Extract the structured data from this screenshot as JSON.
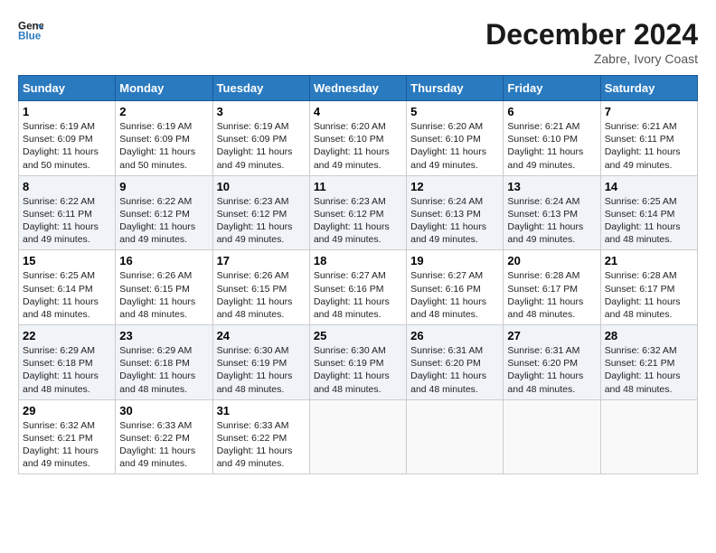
{
  "header": {
    "logo_line1": "General",
    "logo_line2": "Blue",
    "month": "December 2024",
    "location": "Zabre, Ivory Coast"
  },
  "days_of_week": [
    "Sunday",
    "Monday",
    "Tuesday",
    "Wednesday",
    "Thursday",
    "Friday",
    "Saturday"
  ],
  "weeks": [
    [
      {
        "day": "1",
        "sunrise": "6:19 AM",
        "sunset": "6:09 PM",
        "daylight": "11 hours and 50 minutes."
      },
      {
        "day": "2",
        "sunrise": "6:19 AM",
        "sunset": "6:09 PM",
        "daylight": "11 hours and 50 minutes."
      },
      {
        "day": "3",
        "sunrise": "6:19 AM",
        "sunset": "6:09 PM",
        "daylight": "11 hours and 49 minutes."
      },
      {
        "day": "4",
        "sunrise": "6:20 AM",
        "sunset": "6:10 PM",
        "daylight": "11 hours and 49 minutes."
      },
      {
        "day": "5",
        "sunrise": "6:20 AM",
        "sunset": "6:10 PM",
        "daylight": "11 hours and 49 minutes."
      },
      {
        "day": "6",
        "sunrise": "6:21 AM",
        "sunset": "6:10 PM",
        "daylight": "11 hours and 49 minutes."
      },
      {
        "day": "7",
        "sunrise": "6:21 AM",
        "sunset": "6:11 PM",
        "daylight": "11 hours and 49 minutes."
      }
    ],
    [
      {
        "day": "8",
        "sunrise": "6:22 AM",
        "sunset": "6:11 PM",
        "daylight": "11 hours and 49 minutes."
      },
      {
        "day": "9",
        "sunrise": "6:22 AM",
        "sunset": "6:12 PM",
        "daylight": "11 hours and 49 minutes."
      },
      {
        "day": "10",
        "sunrise": "6:23 AM",
        "sunset": "6:12 PM",
        "daylight": "11 hours and 49 minutes."
      },
      {
        "day": "11",
        "sunrise": "6:23 AM",
        "sunset": "6:12 PM",
        "daylight": "11 hours and 49 minutes."
      },
      {
        "day": "12",
        "sunrise": "6:24 AM",
        "sunset": "6:13 PM",
        "daylight": "11 hours and 49 minutes."
      },
      {
        "day": "13",
        "sunrise": "6:24 AM",
        "sunset": "6:13 PM",
        "daylight": "11 hours and 49 minutes."
      },
      {
        "day": "14",
        "sunrise": "6:25 AM",
        "sunset": "6:14 PM",
        "daylight": "11 hours and 48 minutes."
      }
    ],
    [
      {
        "day": "15",
        "sunrise": "6:25 AM",
        "sunset": "6:14 PM",
        "daylight": "11 hours and 48 minutes."
      },
      {
        "day": "16",
        "sunrise": "6:26 AM",
        "sunset": "6:15 PM",
        "daylight": "11 hours and 48 minutes."
      },
      {
        "day": "17",
        "sunrise": "6:26 AM",
        "sunset": "6:15 PM",
        "daylight": "11 hours and 48 minutes."
      },
      {
        "day": "18",
        "sunrise": "6:27 AM",
        "sunset": "6:16 PM",
        "daylight": "11 hours and 48 minutes."
      },
      {
        "day": "19",
        "sunrise": "6:27 AM",
        "sunset": "6:16 PM",
        "daylight": "11 hours and 48 minutes."
      },
      {
        "day": "20",
        "sunrise": "6:28 AM",
        "sunset": "6:17 PM",
        "daylight": "11 hours and 48 minutes."
      },
      {
        "day": "21",
        "sunrise": "6:28 AM",
        "sunset": "6:17 PM",
        "daylight": "11 hours and 48 minutes."
      }
    ],
    [
      {
        "day": "22",
        "sunrise": "6:29 AM",
        "sunset": "6:18 PM",
        "daylight": "11 hours and 48 minutes."
      },
      {
        "day": "23",
        "sunrise": "6:29 AM",
        "sunset": "6:18 PM",
        "daylight": "11 hours and 48 minutes."
      },
      {
        "day": "24",
        "sunrise": "6:30 AM",
        "sunset": "6:19 PM",
        "daylight": "11 hours and 48 minutes."
      },
      {
        "day": "25",
        "sunrise": "6:30 AM",
        "sunset": "6:19 PM",
        "daylight": "11 hours and 48 minutes."
      },
      {
        "day": "26",
        "sunrise": "6:31 AM",
        "sunset": "6:20 PM",
        "daylight": "11 hours and 48 minutes."
      },
      {
        "day": "27",
        "sunrise": "6:31 AM",
        "sunset": "6:20 PM",
        "daylight": "11 hours and 48 minutes."
      },
      {
        "day": "28",
        "sunrise": "6:32 AM",
        "sunset": "6:21 PM",
        "daylight": "11 hours and 48 minutes."
      }
    ],
    [
      {
        "day": "29",
        "sunrise": "6:32 AM",
        "sunset": "6:21 PM",
        "daylight": "11 hours and 49 minutes."
      },
      {
        "day": "30",
        "sunrise": "6:33 AM",
        "sunset": "6:22 PM",
        "daylight": "11 hours and 49 minutes."
      },
      {
        "day": "31",
        "sunrise": "6:33 AM",
        "sunset": "6:22 PM",
        "daylight": "11 hours and 49 minutes."
      },
      null,
      null,
      null,
      null
    ]
  ]
}
